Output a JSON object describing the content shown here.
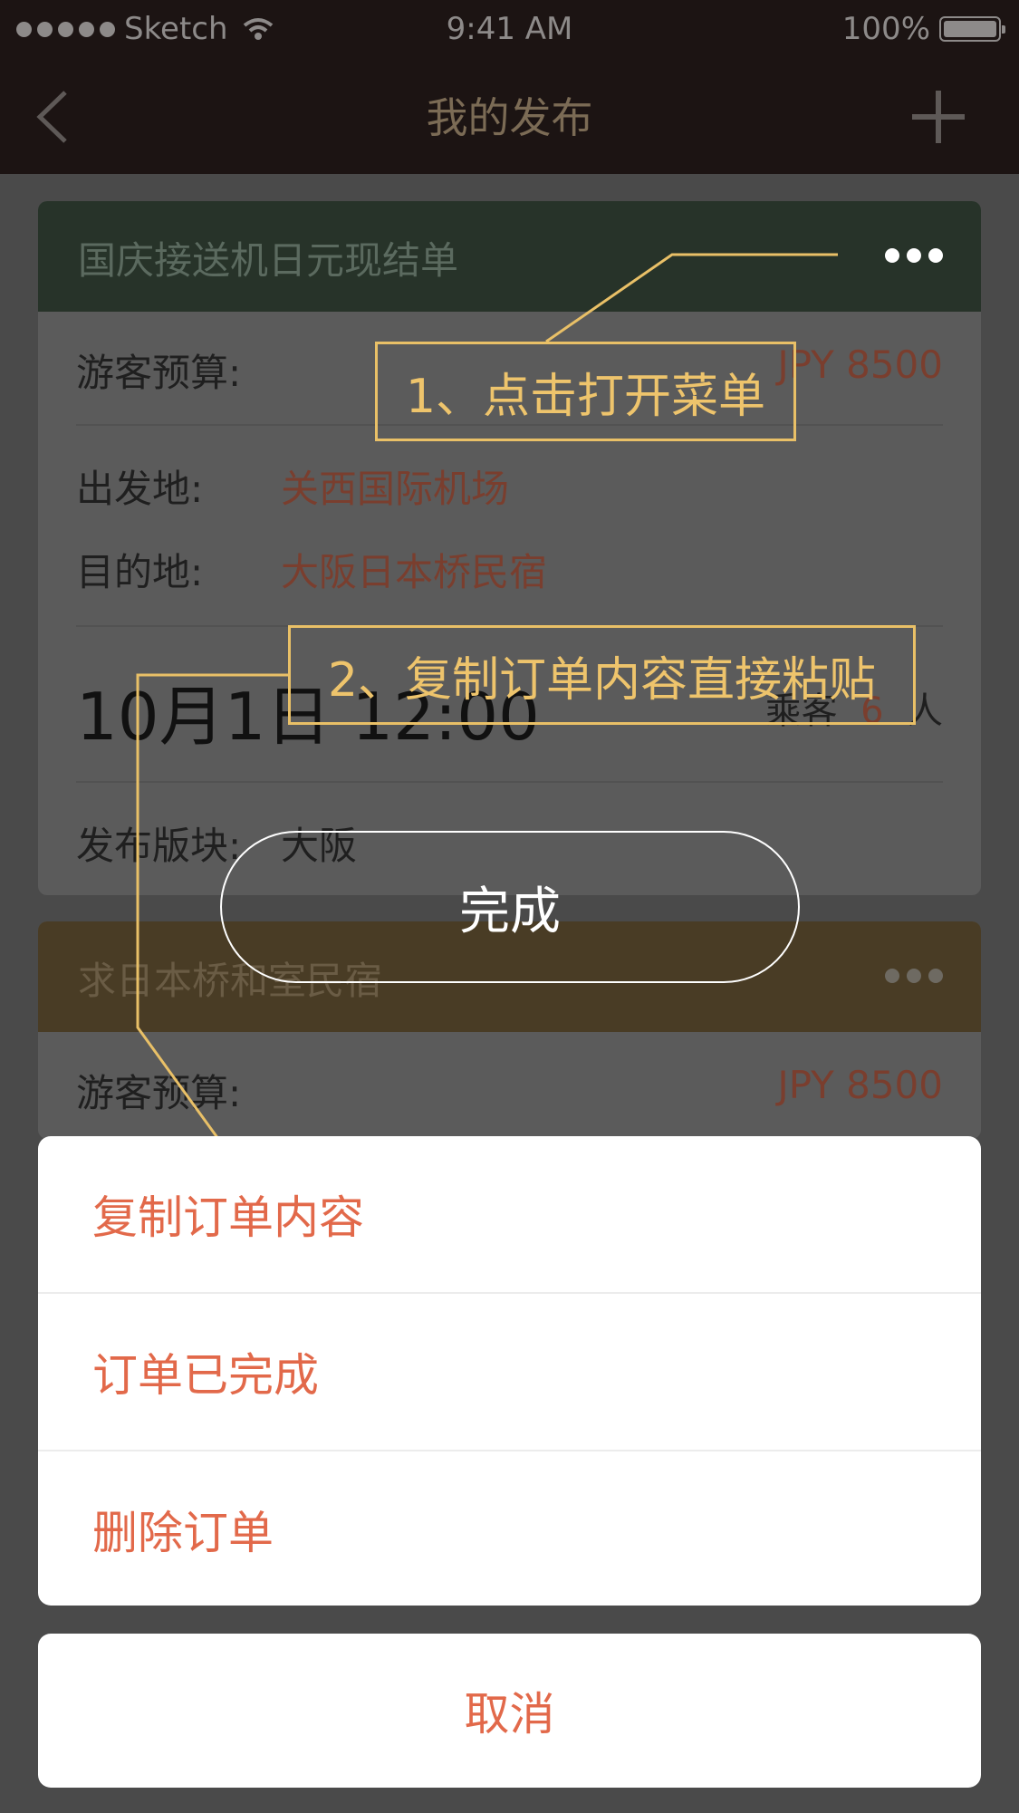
{
  "status_bar": {
    "carrier": "Sketch",
    "time": "9:41 AM",
    "battery": "100%"
  },
  "nav": {
    "title": "我的发布",
    "back_icon": "chevron-left-icon",
    "add_icon": "plus-icon"
  },
  "cards": [
    {
      "title": "国庆接送机日元现结单",
      "header_color": "#273329",
      "budget_label": "游客预算:",
      "budget_value": "JPY 8500",
      "from_label": "出发地:",
      "from_value": "关西国际机场",
      "to_label": "目的地:",
      "to_value": "大阪日本桥民宿",
      "datetime": "10月1日 12:00",
      "passengers_label": "乘客",
      "passengers_value": "6",
      "passengers_unit": "人",
      "section_label": "发布版块:",
      "section_value": "大阪"
    },
    {
      "title": "求日本桥和室民宿",
      "header_color": "#493c25",
      "budget_label": "游客预算:",
      "budget_value": "JPY 8500"
    }
  ],
  "annotations": {
    "step1": "1、点击打开菜单",
    "step2": "2、复制订单内容直接粘贴",
    "done": "完成"
  },
  "action_sheet": {
    "items": [
      "复制订单内容",
      "订单已完成",
      "删除订单"
    ],
    "cancel": "取消"
  },
  "colors": {
    "accent": "#e2694a",
    "annotation": "#e9c067"
  }
}
